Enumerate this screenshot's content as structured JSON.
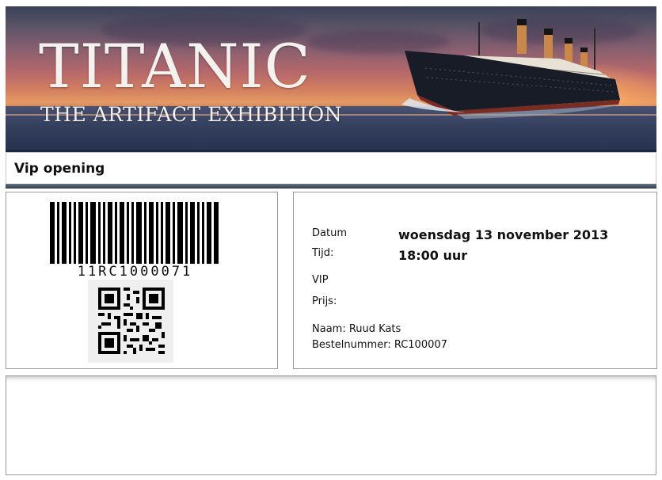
{
  "banner": {
    "title": "TITANIC",
    "subtitle": "THE ARTIFACT EXHIBITION"
  },
  "event": {
    "name": "Vip opening"
  },
  "ticket": {
    "barcode_text": "11RC1000071",
    "date_label": "Datum",
    "date_value": "woensdag 13 november 2013",
    "time_label": "Tijd:",
    "time_value": "18:00 uur",
    "category": "VIP",
    "price_label": "Prijs:",
    "name_line": "Naam: Ruud  Kats",
    "order_line": "Bestelnummer: RC100007"
  },
  "icons": [
    "barcode-icon",
    "qr-code-icon",
    "ship-illustration"
  ]
}
